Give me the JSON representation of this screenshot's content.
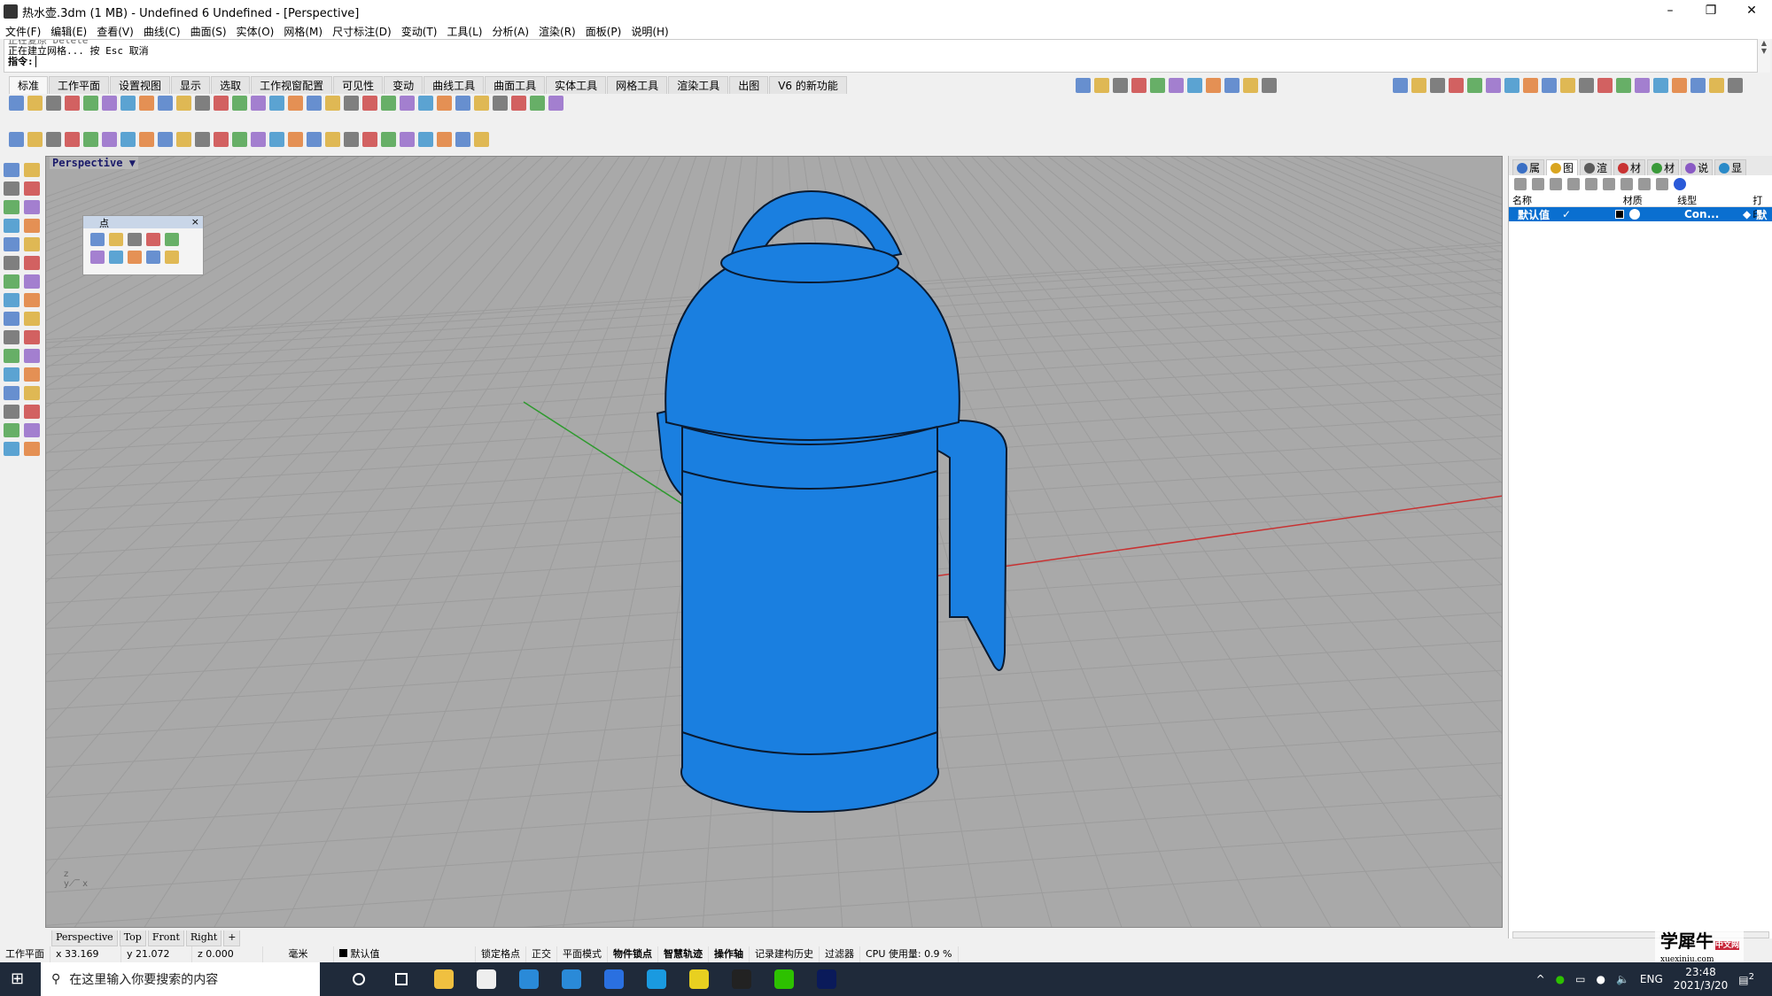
{
  "window": {
    "title": "热水壶.3dm (1 MB) - Undefined 6 Undefined - [Perspective]",
    "minimize": "–",
    "restore": "❐",
    "close": "✕"
  },
  "menu": [
    "文件(F)",
    "编辑(E)",
    "查看(V)",
    "曲线(C)",
    "曲面(S)",
    "实体(O)",
    "网格(M)",
    "尺寸标注(D)",
    "变动(T)",
    "工具(L)",
    "分析(A)",
    "渲染(R)",
    "面板(P)",
    "说明(H)"
  ],
  "command": {
    "history_old": "正在复原 Delete",
    "history": "正在建立网格... 按 Esc 取消",
    "prompt": "指令:",
    "value": ""
  },
  "toolbar_tabs": [
    "标准",
    "工作平面",
    "设置视图",
    "显示",
    "选取",
    "工作视窗配置",
    "可见性",
    "变动",
    "曲线工具",
    "曲面工具",
    "实体工具",
    "网格工具",
    "渲染工具",
    "出图",
    "V6 的新功能"
  ],
  "toolbar_icons": [
    "new-file",
    "open-file",
    "save",
    "print",
    "import",
    "cut",
    "copy",
    "paste",
    "undo",
    "pan",
    "rotate-view",
    "zoom",
    "zoom-window",
    "zoom-extents",
    "zoom-selected",
    "undo-view",
    "four-viewports",
    "cplane",
    "grid",
    "shade",
    "light",
    "lock",
    "color",
    "render",
    "material",
    "sphere",
    "properties",
    "select",
    "options",
    "help"
  ],
  "toolbar2_icons": [
    "point",
    "text",
    "block",
    "extrude",
    "box",
    "surface",
    "loft",
    "sweep",
    "revolve",
    "fillet",
    "mirror",
    "array",
    "move",
    "scale",
    "rotate",
    "trim",
    "split",
    "join",
    "explode",
    "boolean",
    "dimension",
    "curve",
    "offset",
    "project",
    "analyze",
    "arrow"
  ],
  "left_icons": [
    "select",
    "point",
    "polyline",
    "curve",
    "circle",
    "arc",
    "rectangle",
    "polygon",
    "surface",
    "patch",
    "solid-box",
    "sphere",
    "extrude",
    "loft",
    "fillet",
    "chamfer",
    "trim",
    "split",
    "text",
    "dimension",
    "move",
    "copy",
    "mirror",
    "array",
    "rotate",
    "scale",
    "boolean",
    "shell",
    "mesh",
    "render",
    "check",
    "analyze"
  ],
  "viewport": {
    "label": "Perspective",
    "dropdown": "▼",
    "model_color": "#1a7fe0",
    "axis_x_color": "#c83232",
    "axis_y_color": "#2f9a2f"
  },
  "point_panel": {
    "title": "点",
    "close": "×"
  },
  "right_panel": {
    "tabs": [
      "属",
      "图",
      "渲",
      "材",
      "材",
      "说",
      "显"
    ],
    "columns": [
      "名称",
      "材质",
      "线型",
      "打印"
    ],
    "row": {
      "name": "默认值",
      "check": "✓",
      "linetype": "Con...",
      "print": "默"
    }
  },
  "viewport_tabs": [
    "Perspective",
    "Top",
    "Front",
    "Right",
    "+"
  ],
  "status": {
    "cplane": "工作平面",
    "x": "x 33.169",
    "y": "y 21.072",
    "z": "z 0.000",
    "unit": "毫米",
    "layer": "默认值",
    "toggles": [
      {
        "label": "锁定格点",
        "bold": false
      },
      {
        "label": "正交",
        "bold": false
      },
      {
        "label": "平面模式",
        "bold": false
      },
      {
        "label": "物件锁点",
        "bold": true
      },
      {
        "label": "智慧轨迹",
        "bold": true
      },
      {
        "label": "操作轴",
        "bold": true
      },
      {
        "label": "记录建构历史",
        "bold": false
      },
      {
        "label": "过滤器",
        "bold": false
      }
    ],
    "cpu": "CPU 使用量: 0.9 %"
  },
  "taskbar": {
    "search_placeholder": "在这里输入你要搜索的内容",
    "apps": [
      "cortana",
      "task-view",
      "file-explorer",
      "store",
      "mail",
      "browser",
      "feishu",
      "qq-browser",
      "app-yellow",
      "rhino",
      "wechat",
      "photoshop"
    ],
    "tray": {
      "lang": "ENG",
      "time": "23:48",
      "date": "2021/3/20",
      "notifications": "2"
    }
  },
  "watermark": {
    "text": "学犀牛",
    "sub": "xuexiniu.com",
    "badge": "中文网"
  }
}
